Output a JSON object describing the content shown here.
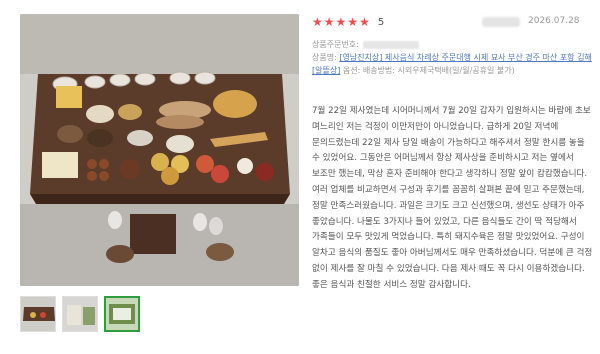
{
  "review": {
    "rating_stars": 5,
    "star_glyph": "★",
    "score": "5",
    "date": "2026.07.28",
    "order_number_label": "상품주문번호:",
    "product_label": "상품명:",
    "product_link": "[영남진치상] 제사음식 차례상 주문대행 시제 묘사 부산 경주 마산 포항 김해 [알뜰상]",
    "option_text": "옵션: 배송방법: 시외우제국택배(일/월/공휴일 불가)",
    "body": "7월 22일 제사였는데 시어머니께서 7월 20일 갑자기 입원하시는 바람에 초보 며느리인 저는 걱정이 이만저만이 아니었습니다. 급하게 20일 저녁에 문의드렸는데 22일 제사 당일 배송이 가능하다고 해주셔서 정말 한시름 놓을 수 있었어요. 그동안은 어머님께서 항상 제사상을 준비하시고 저는 옆에서 보조만 했는데, 막상 혼자 준비해야 한다고 생각하니 정말 앞이 캄캄했습니다. 여러 업체를 비교하면서 구성과 후기를 꼼꼼히 살펴본 끝에 믿고 주문했는데, 정말 만족스러웠습니다. 과일은 크기도 크고 신선했으며, 생선도 상태가 아주 좋았습니다. 나물도 3가지나 들어 있었고, 다른 음식들도 간이 딱 적당해서 가족들이 모두 맛있게 먹었습니다. 특히 돼지수육은 정말 맛있었어요. 구성이 알차고 음식의 품질도 좋아 아버님께서도 매우 만족하셨습니다. 덕분에 큰 걱정 없이 제사를 잘 마칠 수 있었습니다. 다음 제사 때도 꼭 다시 이용하겠습니다. 좋은 음식과 친절한 서비스 정말 감사합니다."
  },
  "colors": {
    "star": "#f04e4e",
    "link": "#4a78c8",
    "thumb_active_border": "#2e9d3d"
  },
  "photos": {
    "main": "review-photo-ancestral-table",
    "thumbnails": [
      "thumb-1",
      "thumb-2",
      "thumb-3"
    ],
    "active_thumbnail": 3
  }
}
